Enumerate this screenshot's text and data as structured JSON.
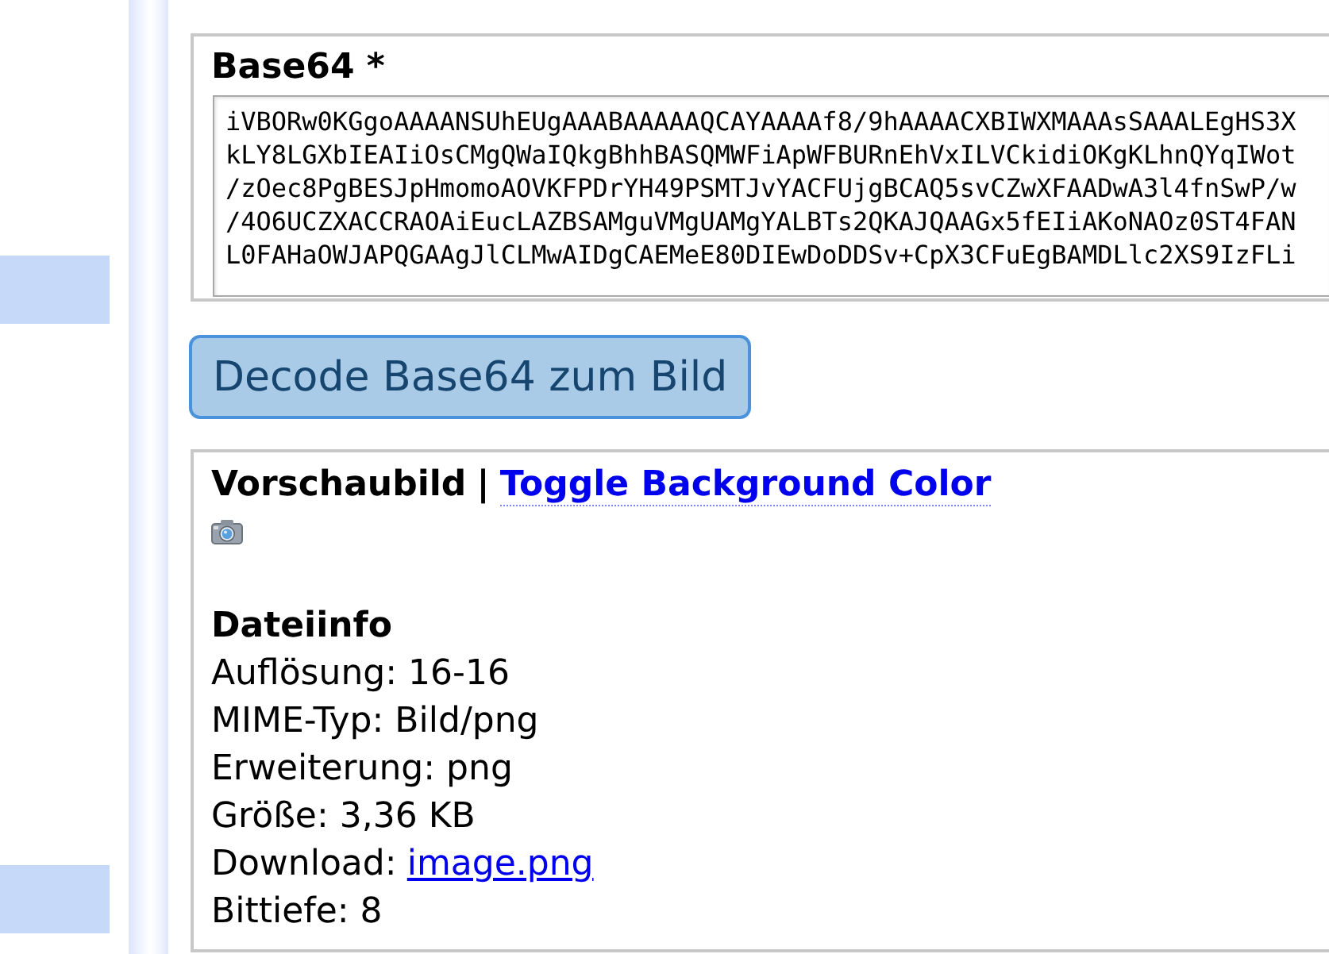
{
  "base64_field": {
    "label": "Base64 *",
    "value_lines": [
      "iVBORw0KGgoAAAANSUhEUgAAABAAAAAQCAYAAAAf8/9hAAAACXBIWXMAAAsSAAALEgHS3X",
      "kLY8LGXbIEAIiOsCMgQWaIQkgBhhBASQMWFiApWFBURnEhVxILVCkidiOKgKLhnQYqIWot",
      "/zOec8PgBESJpHmomoAOVKFPDrYH49PSMTJvYACFUjgBCAQ5svCZwXFAADwA3l4fnSwP/w",
      "/4O6UCZXACCRAOAiEucLAZBSAMguVMgUAMgYALBTs2QKAJQAAGx5fEIiAKoNAOz0ST4FAN",
      "L0FAHaOWJAPQGAAgJlCLMwAIDgCAEMeE80DIEwDoDDSv+CpX3CFuEgBAMDLlc2XS9IzFLi"
    ]
  },
  "decode_button": {
    "label": "Decode Base64 zum Bild"
  },
  "preview": {
    "title": "Vorschaubild",
    "separator": "|",
    "toggle_link": "Toggle Background Color"
  },
  "file_info": {
    "title": "Dateiinfo",
    "rows": [
      {
        "kind": "text",
        "text": "Auflösung: 16-16"
      },
      {
        "kind": "text",
        "text": "MIME-Typ: Bild/png"
      },
      {
        "kind": "text",
        "text": "Erweiterung: png"
      },
      {
        "kind": "text",
        "text": "Größe: 3,36 KB"
      },
      {
        "kind": "link",
        "label": "Download:",
        "link": "image.png"
      },
      {
        "kind": "text",
        "text": "Bittiefe: 8"
      }
    ]
  }
}
